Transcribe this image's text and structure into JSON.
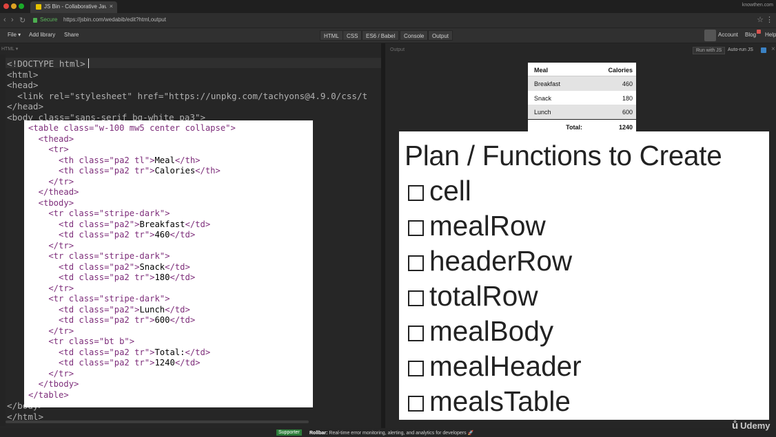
{
  "browser": {
    "tab_title": "JS Bin - Collaborative JavaScr…",
    "tab_close": "×",
    "username": "knowthen.com",
    "secure_label": "Secure",
    "url": "https://jsbin.com/wedabib/edit?html,output",
    "colors": {
      "secure": "#5cb85c",
      "traffic_red": "#e0443e",
      "traffic_yellow": "#dea123",
      "traffic_green": "#1aab29"
    }
  },
  "jsbin_toolbar": {
    "file": "File ▾",
    "add_library": "Add library",
    "share": "Share",
    "panels": [
      "HTML",
      "CSS",
      "ES6 / Babel",
      "Console",
      "Output"
    ],
    "account": "Account",
    "blog": "Blog",
    "help": "Help"
  },
  "editor": {
    "panel_label": "HTML ▾",
    "lines": [
      "<!DOCTYPE html>",
      "<html>",
      "<head>",
      "  <link rel=\"stylesheet\" href=\"https://unpkg.com/tachyons@4.9.0/css/t",
      "</head>",
      "<body class=\"sans-serif bg-white pa3\">",
      "</body>",
      "</html>"
    ]
  },
  "code_card": {
    "lines": [
      {
        "tag1": "<table",
        "rest": " class=\"w-100 mw5 center collapse\">"
      },
      {
        "tag1": "  <thead>",
        "rest": ""
      },
      {
        "tag1": "    <tr>",
        "rest": ""
      },
      {
        "tag1": "      <th",
        "rest": " class=\"pa2 tl\">",
        "text": "Meal",
        "tag2": "</th>"
      },
      {
        "tag1": "      <th",
        "rest": " class=\"pa2 tr\">",
        "text": "Calories",
        "tag2": "</th>"
      },
      {
        "tag1": "    </tr>",
        "rest": ""
      },
      {
        "tag1": "  </thead>",
        "rest": ""
      },
      {
        "tag1": "  <tbody>",
        "rest": ""
      },
      {
        "tag1": "    <tr",
        "rest": " class=\"stripe-dark\">"
      },
      {
        "tag1": "      <td",
        "rest": " class=\"pa2\">",
        "text": "Breakfast",
        "tag2": "</td>"
      },
      {
        "tag1": "      <td",
        "rest": " class=\"pa2 tr\">",
        "text": "460",
        "tag2": "</td>"
      },
      {
        "tag1": "    </tr>",
        "rest": ""
      },
      {
        "tag1": "    <tr",
        "rest": " class=\"stripe-dark\">"
      },
      {
        "tag1": "      <td",
        "rest": " class=\"pa2\">",
        "text": "Snack",
        "tag2": "</td>"
      },
      {
        "tag1": "      <td",
        "rest": " class=\"pa2 tr\">",
        "text": "180",
        "tag2": "</td>"
      },
      {
        "tag1": "    </tr>",
        "rest": ""
      },
      {
        "tag1": "    <tr",
        "rest": " class=\"stripe-dark\">"
      },
      {
        "tag1": "      <td",
        "rest": " class=\"pa2\">",
        "text": "Lunch",
        "tag2": "</td>"
      },
      {
        "tag1": "      <td",
        "rest": " class=\"pa2 tr\">",
        "text": "600",
        "tag2": "</td>"
      },
      {
        "tag1": "    </tr>",
        "rest": ""
      },
      {
        "tag1": "    <tr",
        "rest": " class=\"bt b\">"
      },
      {
        "tag1": "      <td",
        "rest": " class=\"pa2 tr\">",
        "text": "Total:",
        "tag2": "</td>"
      },
      {
        "tag1": "      <td",
        "rest": " class=\"pa2 tr\">",
        "text": "1240",
        "tag2": "</td>"
      },
      {
        "tag1": "    </tr>",
        "rest": ""
      },
      {
        "tag1": "  </tbody>",
        "rest": ""
      },
      {
        "tag1": "</table>",
        "rest": ""
      }
    ]
  },
  "output": {
    "label": "Output",
    "run_with_js": "Run with JS",
    "auto_run": "Auto-run JS",
    "close": "×",
    "table": {
      "header": [
        "Meal",
        "Calories"
      ],
      "rows": [
        {
          "meal": "Breakfast",
          "calories": "460"
        },
        {
          "meal": "Snack",
          "calories": "180"
        },
        {
          "meal": "Lunch",
          "calories": "600"
        }
      ],
      "total_label": "Total:",
      "total_value": "1240"
    }
  },
  "plan": {
    "title": "Plan / Functions to Create",
    "items": [
      "cell",
      "mealRow",
      "headerRow",
      "totalRow",
      "mealBody",
      "mealHeader",
      "mealsTable"
    ]
  },
  "footer": {
    "supporter": "Supporter",
    "rollbar_brand": "Rollbar:",
    "rollbar_text": " Real-time error monitoring, alerting, and analytics for developers 🚀"
  },
  "watermark": {
    "brand": "Udemy"
  }
}
